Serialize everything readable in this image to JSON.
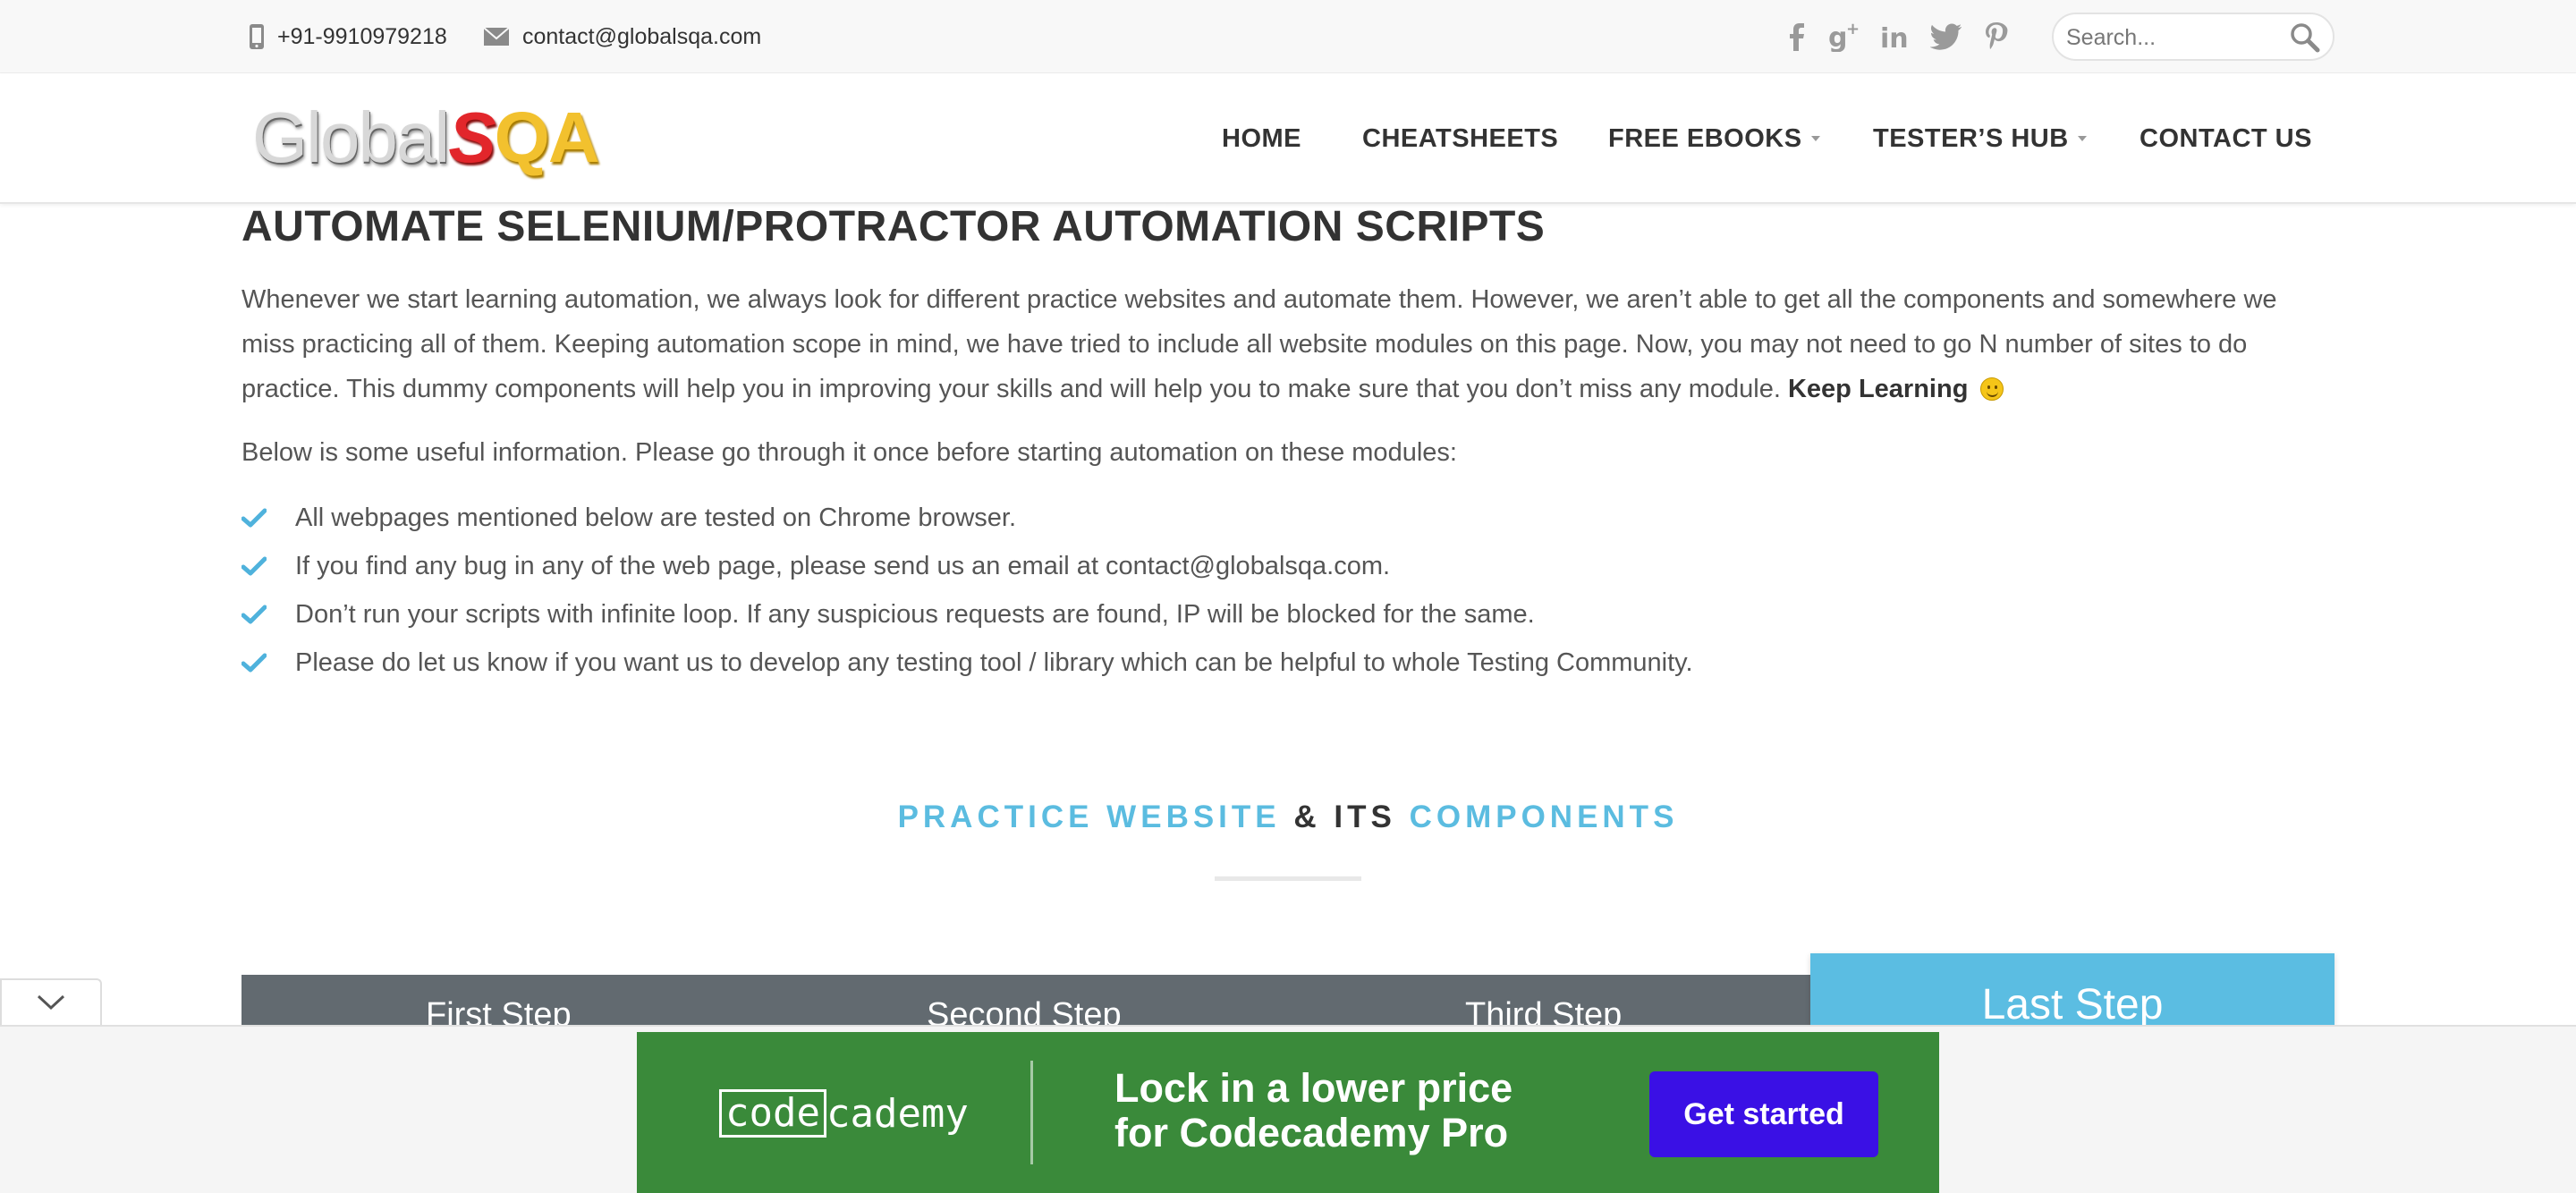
{
  "topbar": {
    "phone": "+91-9910979218",
    "email": "contact@globalsqa.com",
    "phone_icon": "mobile-phone-icon",
    "email_icon": "envelope-icon",
    "social": [
      {
        "name": "facebook-icon",
        "glyph": "f"
      },
      {
        "name": "google-plus-icon",
        "glyph": "g+"
      },
      {
        "name": "linkedin-icon",
        "glyph": "in"
      },
      {
        "name": "twitter-icon",
        "glyph": "t"
      },
      {
        "name": "pinterest-icon",
        "glyph": "p"
      }
    ],
    "search": {
      "placeholder": "Search...",
      "icon": "search-icon"
    }
  },
  "header": {
    "logo": {
      "part1": "Global",
      "part2": "S",
      "part3": "QA"
    },
    "nav": [
      {
        "label": "HOME",
        "dropdown": false
      },
      {
        "label": "CHEATSHEETS",
        "dropdown": false
      },
      {
        "label": "FREE EBOOKS",
        "dropdown": true
      },
      {
        "label": "TESTER’S HUB",
        "dropdown": true
      },
      {
        "label": "CONTACT US",
        "dropdown": false
      }
    ]
  },
  "main": {
    "title": "AUTOMATE SELENIUM/PROTRACTOR AUTOMATION  SCRIPTS",
    "intro": "Whenever we start learning automation, we always look for different practice websites and automate them. However, we aren’t able to get all the components and somewhere we miss practicing all of them. Keeping automation scope in mind, we have tried to include all website modules on this page. Now, you may not need to go N number of sites to do practice. This dummy components will help you in improving your skills and will help you to make sure that you don’t miss any module.",
    "intro_bold": "Keep Learning",
    "below": "Below is some useful information. Please go through it once before starting automation on these modules:",
    "list": [
      "All webpages mentioned below are tested on Chrome browser.",
      "If you find any bug in any of the web page, please send us an email at contact@globalsqa.com.",
      "Don’t run your scripts with infinite loop. If any suspicious requests are found, IP will be blocked for the same.",
      "Please do let us know if you want us to develop any testing tool / library which can be helpful to whole Testing Community."
    ],
    "section": {
      "part1": "PRACTICE WEBSITE",
      "part2": "& ITS",
      "part3": "COMPONENTS"
    },
    "steps": [
      "First Step",
      "Second Step",
      "Third Step"
    ],
    "last_step": "Last Step"
  },
  "ad": {
    "brand_boxed": "code",
    "brand_rest": "cademy",
    "line1": "Lock in a lower price",
    "line2": "for Codecademy Pro",
    "cta": "Get started"
  },
  "colors": {
    "accent": "#5bbce0",
    "steps_bg": "#626a70",
    "ad_bg": "#3a8a3a",
    "ad_button": "#3a10e5"
  }
}
